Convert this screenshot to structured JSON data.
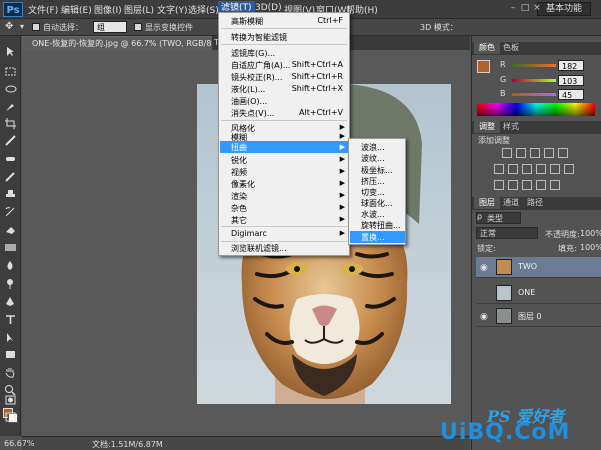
{
  "app": {
    "logo": "Ps",
    "workspace": "基本功能"
  },
  "menubar": {
    "items": [
      "文件(F)",
      "编辑(E)",
      "图像(I)",
      "图层(L)",
      "文字(Y)",
      "选择(S)",
      "滤镜(T)",
      "3D(D)",
      "视图(V)",
      "窗口(W)",
      "帮助(H)"
    ]
  },
  "options": {
    "auto_select": "自动选择：",
    "auto_select_value": "组",
    "show_transform": "显示变换控件",
    "mode_3d": "3D 模式："
  },
  "document": {
    "tab_title": "ONE-恢复的-恢复的.jpg @ 66.7% (TWO, RGB/8#) *",
    "tab2": "T"
  },
  "filter_menu": {
    "items": [
      {
        "label": "高斯模糊",
        "shortcut": "Ctrl+F"
      },
      {
        "label": "转换为智能滤镜",
        "shortcut": ""
      },
      {
        "label": "滤镜库(G)...",
        "shortcut": ""
      },
      {
        "label": "自适应广角(A)...",
        "shortcut": "Shift+Ctrl+A"
      },
      {
        "label": "镜头校正(R)...",
        "shortcut": "Shift+Ctrl+R"
      },
      {
        "label": "液化(L)...",
        "shortcut": "Shift+Ctrl+X"
      },
      {
        "label": "油画(O)...",
        "shortcut": ""
      },
      {
        "label": "消失点(V)...",
        "shortcut": "Alt+Ctrl+V"
      },
      {
        "label": "风格化",
        "shortcut": ""
      },
      {
        "label": "模糊",
        "shortcut": ""
      },
      {
        "label": "扭曲",
        "shortcut": ""
      },
      {
        "label": "锐化",
        "shortcut": ""
      },
      {
        "label": "视频",
        "shortcut": ""
      },
      {
        "label": "像素化",
        "shortcut": ""
      },
      {
        "label": "渲染",
        "shortcut": ""
      },
      {
        "label": "杂色",
        "shortcut": ""
      },
      {
        "label": "其它",
        "shortcut": ""
      },
      {
        "label": "Digimarc",
        "shortcut": ""
      },
      {
        "label": "浏览联机滤镜...",
        "shortcut": ""
      }
    ],
    "highlighted": "扭曲"
  },
  "distort_submenu": {
    "items": [
      "波浪...",
      "波纹...",
      "极坐标...",
      "挤压...",
      "切变...",
      "球面化...",
      "水波...",
      "旋转扭曲...",
      "置换..."
    ],
    "highlighted": "置换..."
  },
  "color_panel": {
    "tabs": [
      "颜色",
      "色板"
    ],
    "channels": [
      {
        "label": "R",
        "value": "182"
      },
      {
        "label": "G",
        "value": "103"
      },
      {
        "label": "B",
        "value": "45"
      }
    ],
    "fg_color": "#b2612d"
  },
  "adjust_panel": {
    "tabs": [
      "调整",
      "样式"
    ],
    "heading": "添加调整"
  },
  "layers_panel": {
    "tabs": [
      "图层",
      "通道",
      "路径"
    ],
    "filter_type": "类型",
    "blend_mode": "正常",
    "opacity_label": "不透明度:",
    "opacity_value": "100%",
    "lock_label": "锁定:",
    "fill_label": "填充:",
    "fill_value": "100%",
    "layers": [
      {
        "name": "TWO",
        "visible": true,
        "selected": true
      },
      {
        "name": "ONE",
        "visible": false,
        "selected": false
      },
      {
        "name": "图层 0",
        "visible": true,
        "selected": false
      }
    ]
  },
  "status": {
    "zoom": "66.67%",
    "doc": "文档:1.51M/6.87M"
  },
  "watermark": {
    "line1": "PS 爱好者",
    "line2": "UiBQ.CoM"
  }
}
